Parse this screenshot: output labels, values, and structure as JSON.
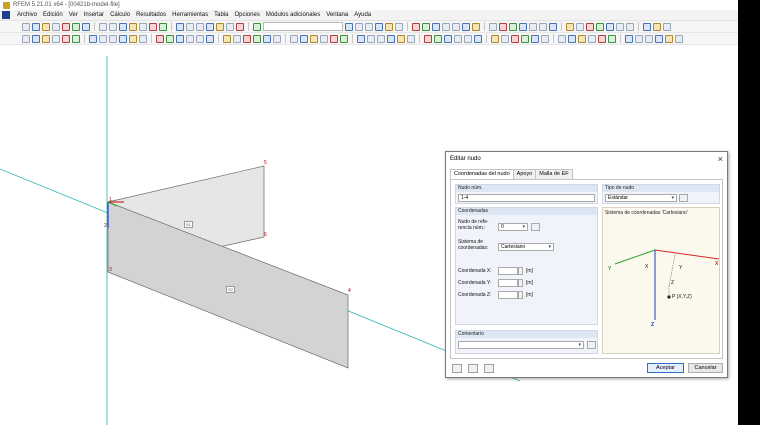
{
  "window": {
    "title": "RFEM 5.21.01 x64 - [00421b-model-file]"
  },
  "menu": {
    "items": [
      "Archivo",
      "Edición",
      "Ver",
      "Insertar",
      "Cálculo",
      "Resultados",
      "Herramientas",
      "Tabla",
      "Opciones",
      "Módulos adicionales",
      "Ventana",
      "Ayuda"
    ]
  },
  "model": {
    "node_labels": [
      "1",
      "2",
      "3",
      "4",
      "5",
      "6"
    ],
    "surface_labels": [
      "S1",
      "S2"
    ],
    "colors": {
      "surface_fill": "#d3d3d3",
      "surface_fill_light": "#e6e6e6",
      "guide_line": "#30b4b4",
      "axis_y": "#2ca02c",
      "axis_z": "#1f3fbf",
      "axis_x": "#d62728"
    }
  },
  "dialog": {
    "title": "Editar nudo",
    "tabs": [
      "Coordenadas del nudo",
      "Apoyo",
      "Malla de EF"
    ],
    "node_group": {
      "header": "Nudo núm.",
      "value": "1-4"
    },
    "type_group": {
      "header": "Tipo de nudo",
      "value": "Estándar"
    },
    "coords_group": {
      "header": "Coordenadas",
      "ref_node_label": "Nudo de refe-rencia núm.:",
      "ref_node_value": "0",
      "system_label": "Sistema de coordenadas:",
      "system_value": "Cartesiano",
      "coord_x_label": "Coordenada X:",
      "coord_y_label": "Coordenada Y:",
      "coord_z_label": "Coordenada Z:",
      "unit": "[m]"
    },
    "comment_group": {
      "header": "Comentario"
    },
    "preview": {
      "caption": "Sistema de coordenadas 'Cartesiano'",
      "axis_x": "X",
      "axis_y": "Y",
      "axis_z": "Z",
      "point_label": "P (X,Y,Z)",
      "x_small": "X",
      "y_small": "Y",
      "z_small": "Z"
    },
    "buttons": {
      "ok": "Aceptar",
      "cancel": "Cancelar"
    }
  }
}
